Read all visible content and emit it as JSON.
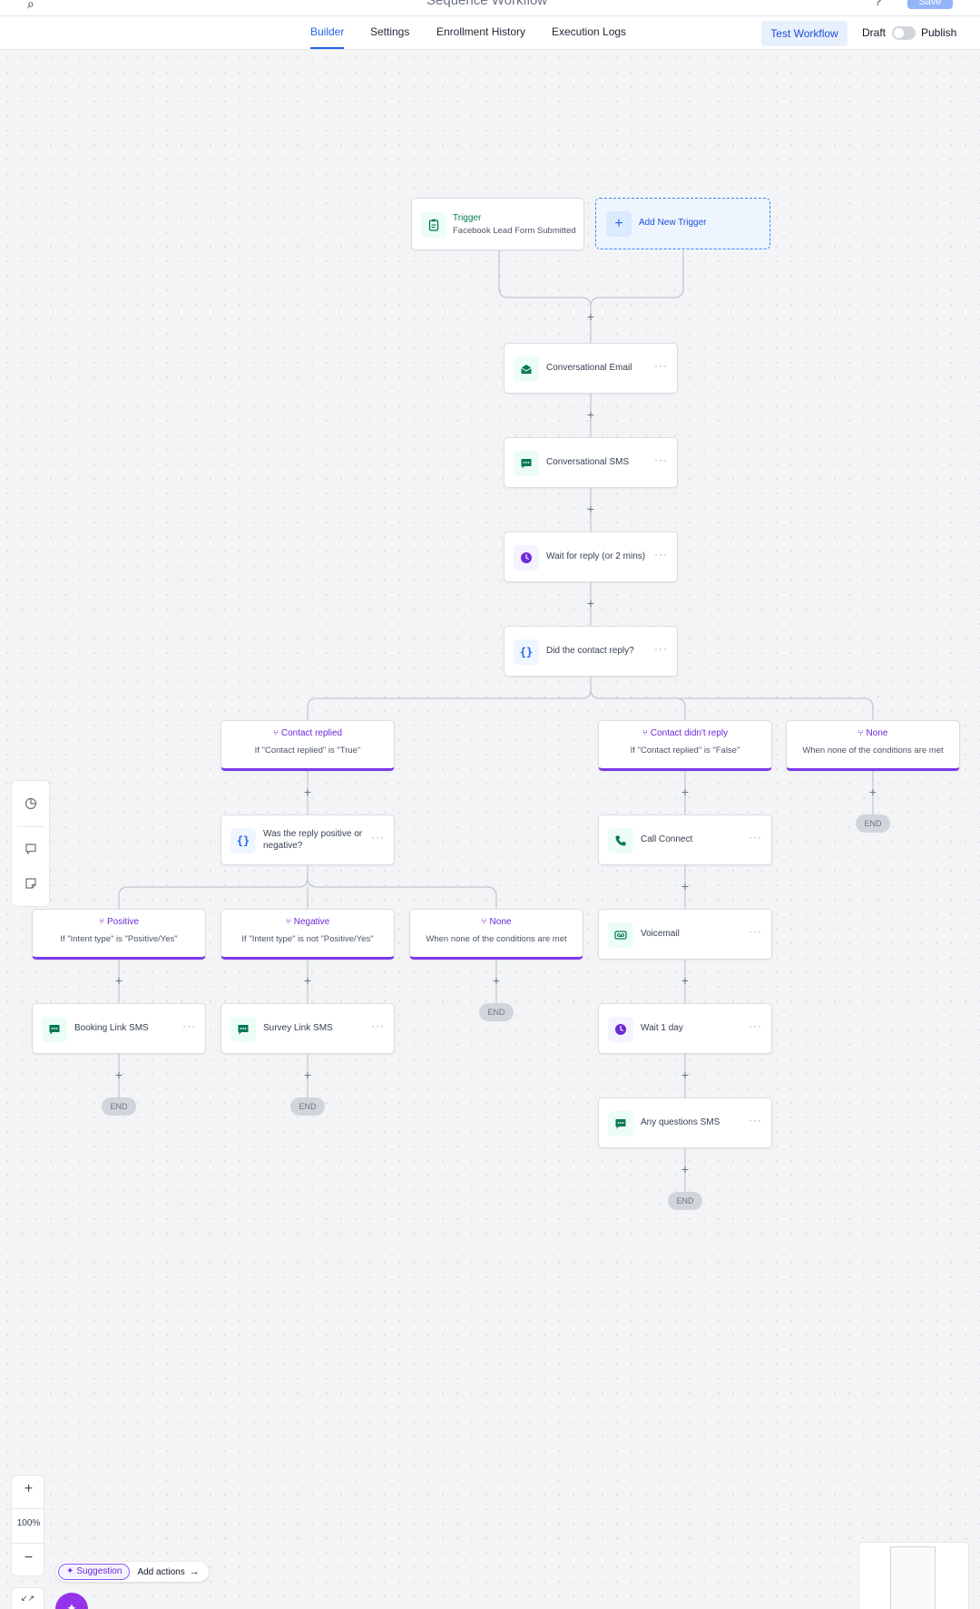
{
  "header": {
    "title": "Sequence Workflow",
    "save_label": "Save"
  },
  "tabs": [
    {
      "label": "Builder",
      "active": true
    },
    {
      "label": "Settings",
      "active": false
    },
    {
      "label": "Enrollment History",
      "active": false
    },
    {
      "label": "Execution Logs",
      "active": false
    }
  ],
  "toolbar": {
    "test_label": "Test Workflow",
    "draft_label": "Draft",
    "publish_label": "Publish",
    "publish_toggle_on": false
  },
  "trigger": {
    "title": "Trigger",
    "subtitle": "Facebook Lead Form Submitted",
    "add_label": "Add New Trigger"
  },
  "steps": {
    "email": "Conversational Email",
    "sms": "Conversational SMS",
    "wait_reply": "Wait for reply (or 2 mins)",
    "condition": "Did the contact reply?",
    "reply_condition": "Was the reply positive or negative?",
    "call": "Call Connect",
    "voicemail": "Voicemail",
    "wait_day": "Wait 1 day",
    "questions_sms": "Any questions SMS",
    "booking_sms": "Booking Link SMS",
    "survey_sms": "Survey Link SMS"
  },
  "branches": {
    "replied": {
      "title": "Contact replied",
      "subtitle": "If \"Contact replied\" is \"True\""
    },
    "not_replied": {
      "title": "Contact didn't reply",
      "subtitle": "If \"Contact replied\" is \"False\""
    },
    "none_top": {
      "title": "None",
      "subtitle": "When none of the conditions are met"
    },
    "positive": {
      "title": "Positive",
      "subtitle": "If \"Intent type\" is \"Positive/Yes\""
    },
    "negative": {
      "title": "Negative",
      "subtitle": "If \"Intent type\" is not \"Positive/Yes\""
    },
    "none_sub": {
      "title": "None",
      "subtitle": "When none of the conditions are met"
    }
  },
  "end_label": "END",
  "plus_label": "+",
  "menu_label": "···",
  "zoom": {
    "in": "+",
    "level": "100%",
    "out": "−"
  },
  "suggestion": {
    "pill": "Suggestion",
    "action": "Add actions"
  },
  "colors": {
    "accent": "#2563eb",
    "branch": "#7c3aed",
    "sms_green": "#047857",
    "fab": "#9333ea"
  }
}
